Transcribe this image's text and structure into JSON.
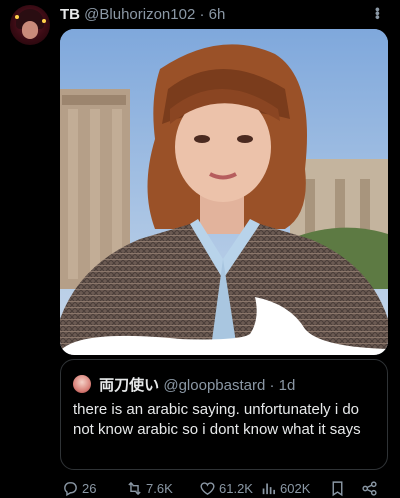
{
  "tweet": {
    "display_name": "TB",
    "handle": "@Bluhorizon102",
    "separator": "·",
    "time": "6h"
  },
  "quote": {
    "display_name": "両刀使い",
    "handle": "@gloopbastard",
    "separator": "·",
    "time": "1d",
    "text": "there is an arabic saying. unfortunately i do not know arabic so i dont know what it says"
  },
  "actions": {
    "replies": "26",
    "retweets": "7.6K",
    "likes": "61.2K",
    "views": "602K"
  },
  "icons": {
    "more": "more-dots-icon",
    "reply": "reply-icon",
    "retweet": "retweet-icon",
    "like": "heart-icon",
    "views": "views-icon",
    "bookmark": "bookmark-icon",
    "share": "share-icon"
  }
}
